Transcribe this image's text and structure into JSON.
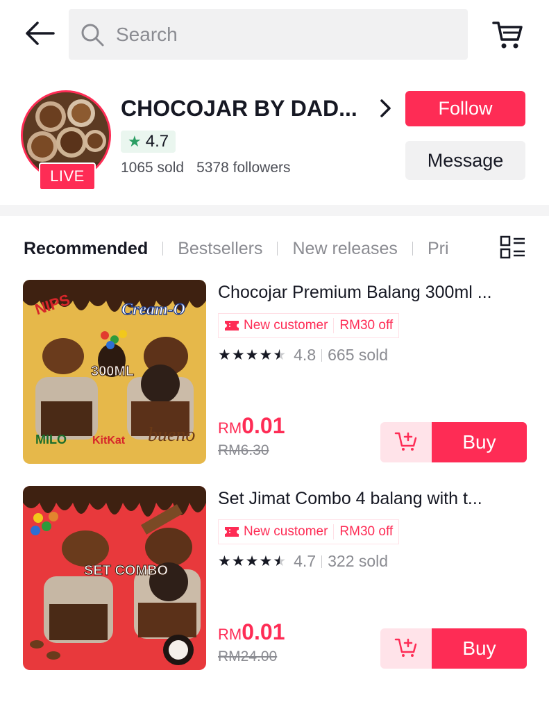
{
  "search": {
    "placeholder": "Search"
  },
  "icons": {
    "back": "arrow-left-icon",
    "search": "search-icon",
    "cart": "shopping-cart-icon",
    "grid": "grid-list-view-icon",
    "star": "star-icon",
    "tag": "ticket-icon",
    "add_to_cart": "add-to-cart-icon"
  },
  "colors": {
    "accent": "#fe2c55",
    "rating_green": "#2a9d63",
    "muted": "#8a8b91"
  },
  "shop": {
    "name": "CHOCOJAR BY DAD...",
    "live_badge": "LIVE",
    "rating": "4.7",
    "sold": "1065 sold",
    "followers": "5378 followers",
    "follow_label": "Follow",
    "message_label": "Message"
  },
  "tabs": [
    {
      "label": "Recommended",
      "active": true
    },
    {
      "label": "Bestsellers",
      "active": false
    },
    {
      "label": "New releases",
      "active": false
    },
    {
      "label": "Pri",
      "active": false
    }
  ],
  "products": [
    {
      "title": "Chocojar Premium Balang 300ml ...",
      "promo_label": "New customer",
      "promo_value": "RM30 off",
      "rating": "4.8",
      "stars": 4.5,
      "sold": "665 sold",
      "currency": "RM",
      "price": "0.01",
      "old_price": "RM6.30",
      "buy_label": "Buy",
      "image_text": {
        "size": "300ML",
        "brand1": "NIPS",
        "brand2": "Cream-O",
        "brand3": "MILO",
        "brand4": "KitKat",
        "brand5": "bueno"
      }
    },
    {
      "title": "Set Jimat Combo 4 balang with t...",
      "promo_label": "New customer",
      "promo_value": "RM30 off",
      "rating": "4.7",
      "stars": 4.5,
      "sold": "322 sold",
      "currency": "RM",
      "price": "0.01",
      "old_price": "RM24.00",
      "buy_label": "Buy",
      "image_text": {
        "label": "SET COMBO"
      }
    }
  ]
}
